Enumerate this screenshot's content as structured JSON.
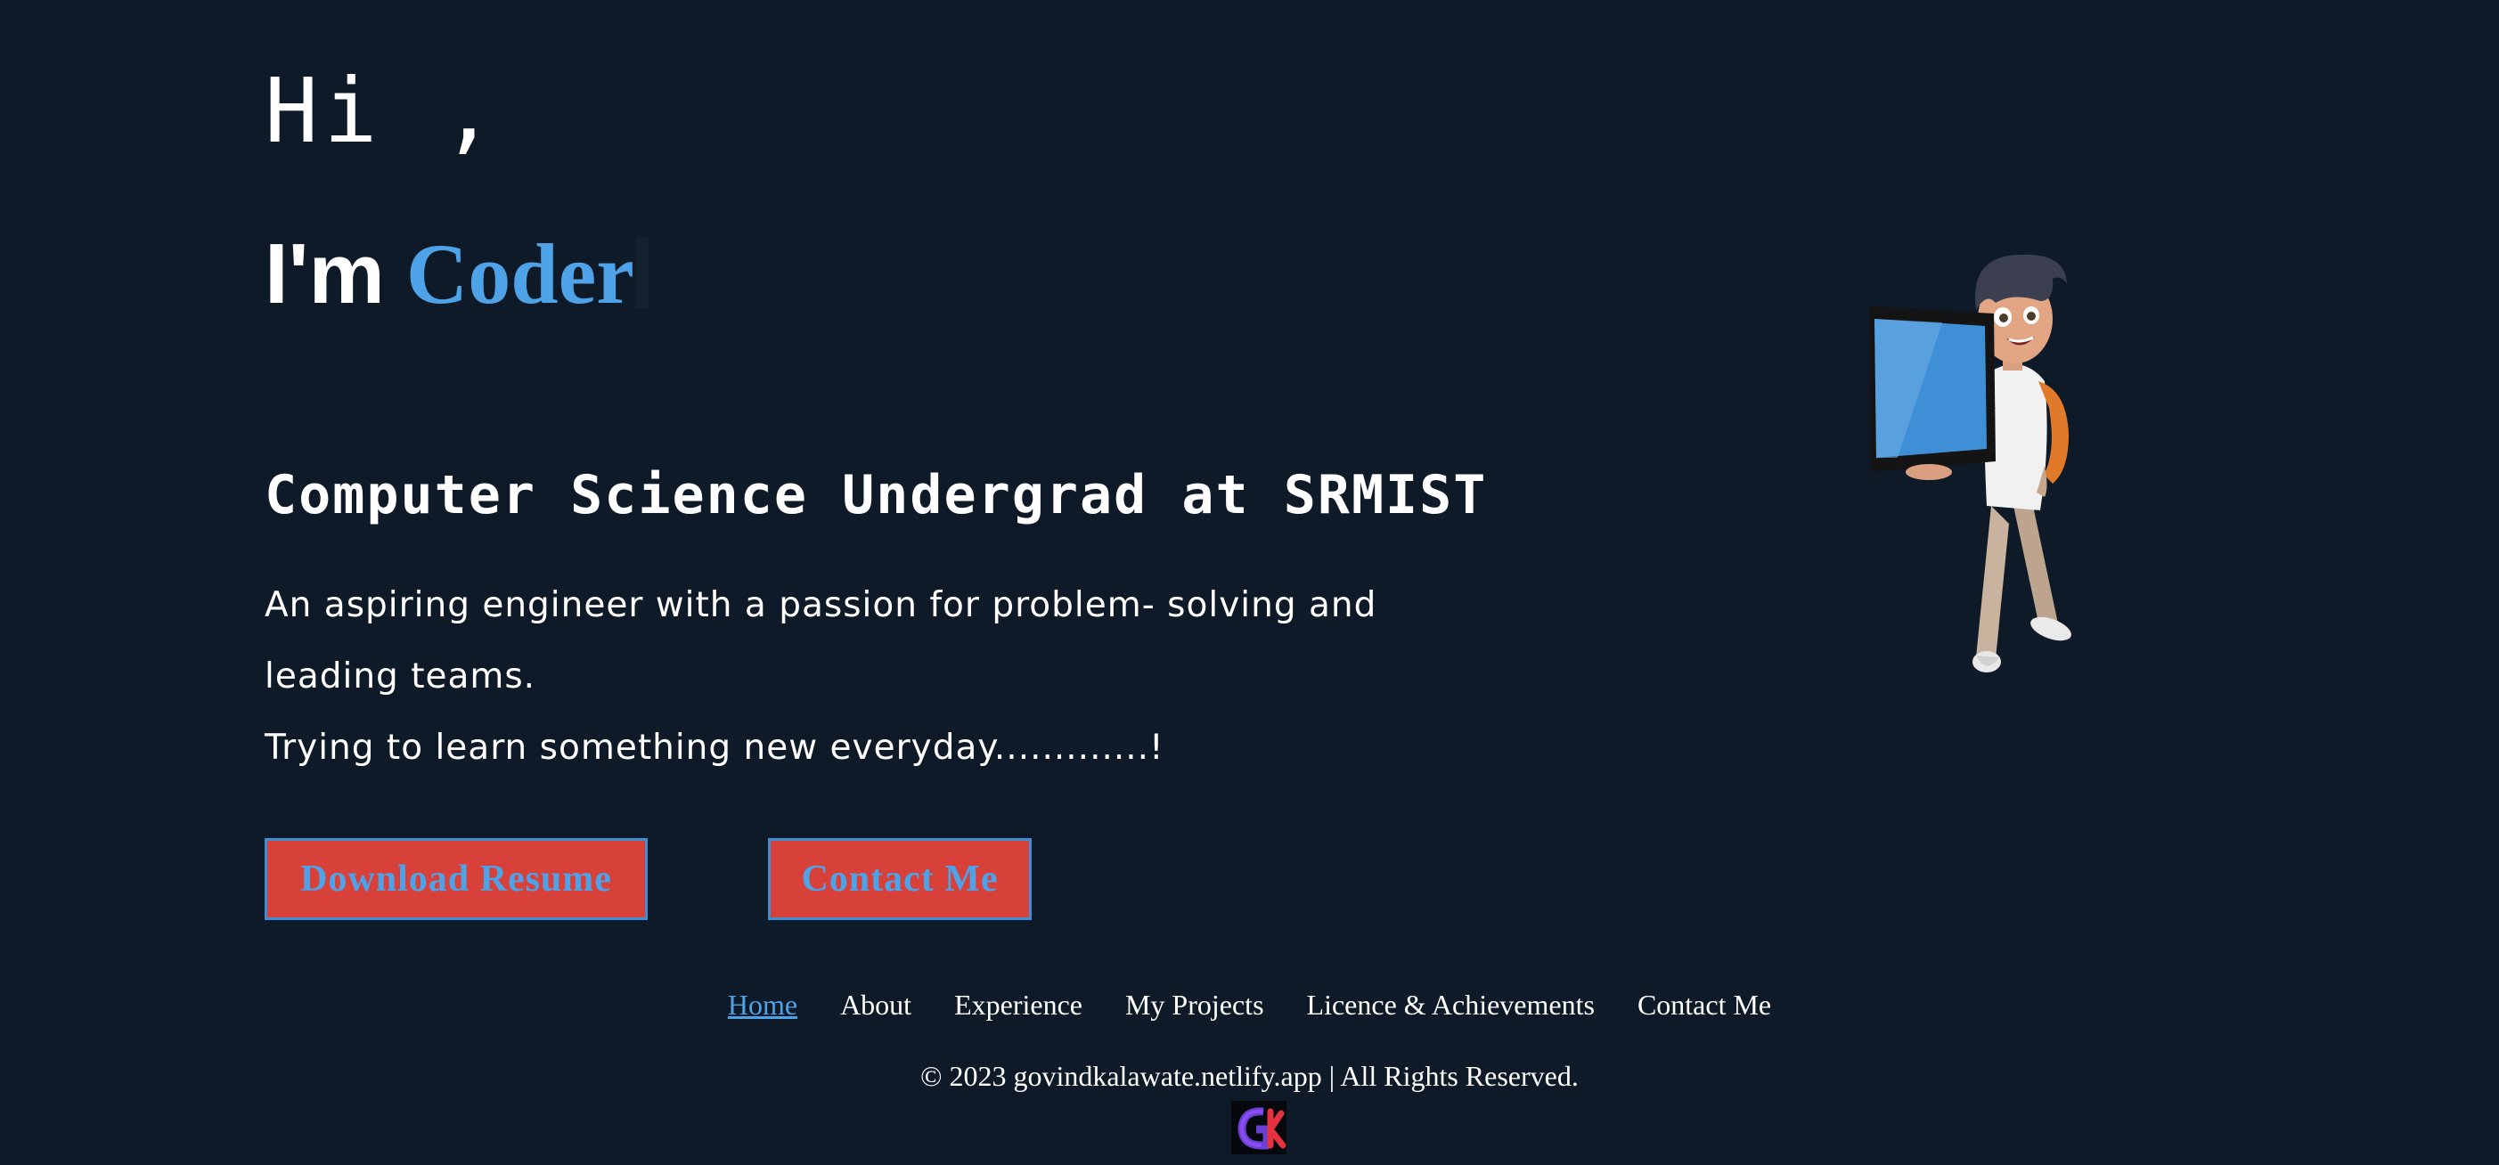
{
  "hero": {
    "greeting": "Hi ,",
    "headline_prefix": "I'm",
    "headline_role": "Coder",
    "subtitle": "Computer Science Undergrad at SRMIST",
    "bio_line1": "An aspiring engineer with a passion for problem- solving and leading teams.",
    "bio_line2": "Trying to learn something new everyday.............!",
    "download_resume_label": "Download Resume",
    "contact_me_label": "Contact Me"
  },
  "footer": {
    "nav": [
      {
        "label": "Home"
      },
      {
        "label": "About"
      },
      {
        "label": "Experience"
      },
      {
        "label": "My Projects"
      },
      {
        "label": "Licence & Achievements"
      },
      {
        "label": "Contact Me"
      }
    ],
    "copyright": "© 2023 govindkalawate.netlify.app | All Rights Reserved.",
    "logo_text": "GK"
  },
  "colors": {
    "background": "#0e1a27",
    "accent": "#4ea3e8",
    "button_bg": "#d8413a"
  },
  "icons": {
    "avatar": "cartoon-boy-with-tablet-illustration",
    "logo": "gk-logo"
  }
}
